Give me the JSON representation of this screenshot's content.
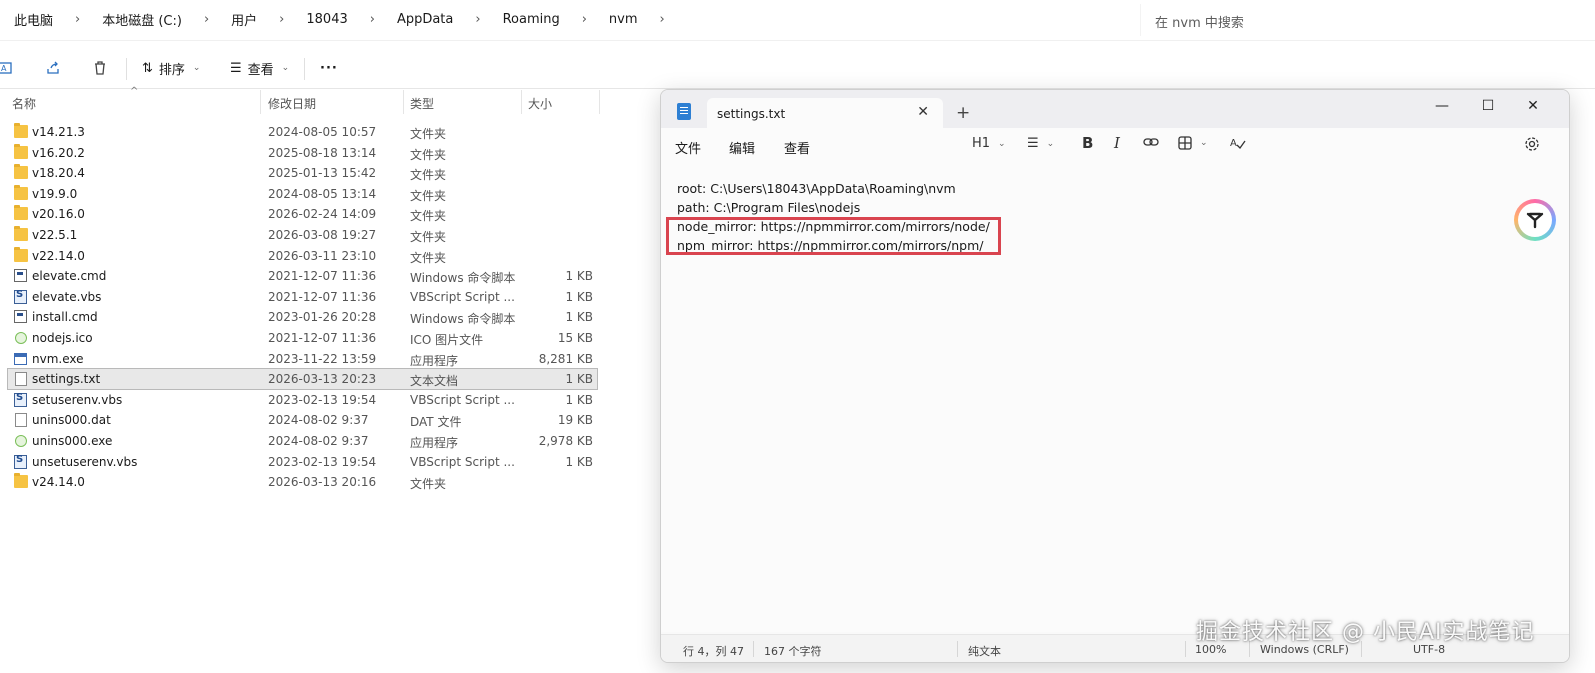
{
  "address_bar": {
    "crumbs": [
      "此电脑",
      "本地磁盘 (C:)",
      "用户",
      "18043",
      "AppData",
      "Roaming",
      "nvm"
    ],
    "search_placeholder": "在 nvm 中搜索"
  },
  "toolbar": {
    "sort_label": "排序",
    "view_label": "查看",
    "more_label": "···"
  },
  "file_list": {
    "columns": {
      "name": "名称",
      "date": "修改日期",
      "type": "类型",
      "size": "大小"
    },
    "rows": [
      {
        "name": "v14.21.3",
        "date": "2024-08-05 10:57",
        "type": "文件夹",
        "size": "",
        "icon": "folder"
      },
      {
        "name": "v16.20.2",
        "date": "2025-08-18 13:14",
        "type": "文件夹",
        "size": "",
        "icon": "folder"
      },
      {
        "name": "v18.20.4",
        "date": "2025-01-13 15:42",
        "type": "文件夹",
        "size": "",
        "icon": "folder"
      },
      {
        "name": "v19.9.0",
        "date": "2024-08-05 13:14",
        "type": "文件夹",
        "size": "",
        "icon": "folder"
      },
      {
        "name": "v20.16.0",
        "date": "2026-02-24 14:09",
        "type": "文件夹",
        "size": "",
        "icon": "folder"
      },
      {
        "name": "v22.5.1",
        "date": "2026-03-08 19:27",
        "type": "文件夹",
        "size": "",
        "icon": "folder"
      },
      {
        "name": "v22.14.0",
        "date": "2026-03-11 23:10",
        "type": "文件夹",
        "size": "",
        "icon": "folder"
      },
      {
        "name": "elevate.cmd",
        "date": "2021-12-07 11:36",
        "type": "Windows 命令脚本",
        "size": "1 KB",
        "icon": "cmd"
      },
      {
        "name": "elevate.vbs",
        "date": "2021-12-07 11:36",
        "type": "VBScript Script ...",
        "size": "1 KB",
        "icon": "vbs"
      },
      {
        "name": "install.cmd",
        "date": "2023-01-26 20:28",
        "type": "Windows 命令脚本",
        "size": "1 KB",
        "icon": "cmd"
      },
      {
        "name": "nodejs.ico",
        "date": "2021-12-07 11:36",
        "type": "ICO 图片文件",
        "size": "15 KB",
        "icon": "node"
      },
      {
        "name": "nvm.exe",
        "date": "2023-11-22 13:59",
        "type": "应用程序",
        "size": "8,281 KB",
        "icon": "exe"
      },
      {
        "name": "settings.txt",
        "date": "2026-03-13 20:23",
        "type": "文本文档",
        "size": "1 KB",
        "icon": "doc",
        "selected": true
      },
      {
        "name": "setuserenv.vbs",
        "date": "2023-02-13 19:54",
        "type": "VBScript Script ...",
        "size": "1 KB",
        "icon": "vbs"
      },
      {
        "name": "unins000.dat",
        "date": "2024-08-02 9:37",
        "type": "DAT 文件",
        "size": "19 KB",
        "icon": "doc"
      },
      {
        "name": "unins000.exe",
        "date": "2024-08-02 9:37",
        "type": "应用程序",
        "size": "2,978 KB",
        "icon": "node"
      },
      {
        "name": "unsetuserenv.vbs",
        "date": "2023-02-13 19:54",
        "type": "VBScript Script ...",
        "size": "1 KB",
        "icon": "vbs"
      },
      {
        "name": "v24.14.0",
        "date": "2026-03-13 20:16",
        "type": "文件夹",
        "size": "",
        "icon": "folder"
      }
    ]
  },
  "notepad": {
    "tab_title": "settings.txt",
    "menus": {
      "file": "文件",
      "edit": "编辑",
      "view": "查看"
    },
    "heading_label": "H1",
    "lines": [
      "root: C:\\Users\\18043\\AppData\\Roaming\\nvm",
      "path: C:\\Program Files\\nodejs",
      "node_mirror: https://npmmirror.com/mirrors/node/",
      "npm_mirror: https://npmmirror.com/mirrors/npm/"
    ],
    "status": {
      "position": "行 4，列 47",
      "char_count": "167 个字符",
      "format": "纯文本",
      "zoom": "100%",
      "line_ending": "Windows (CRLF)",
      "encoding": "UTF-8"
    },
    "highlight_color": "#d9444f"
  },
  "watermark": "掘金技术社区 @ 小民AI实战笔记",
  "accent_color": "#2b6fbf"
}
